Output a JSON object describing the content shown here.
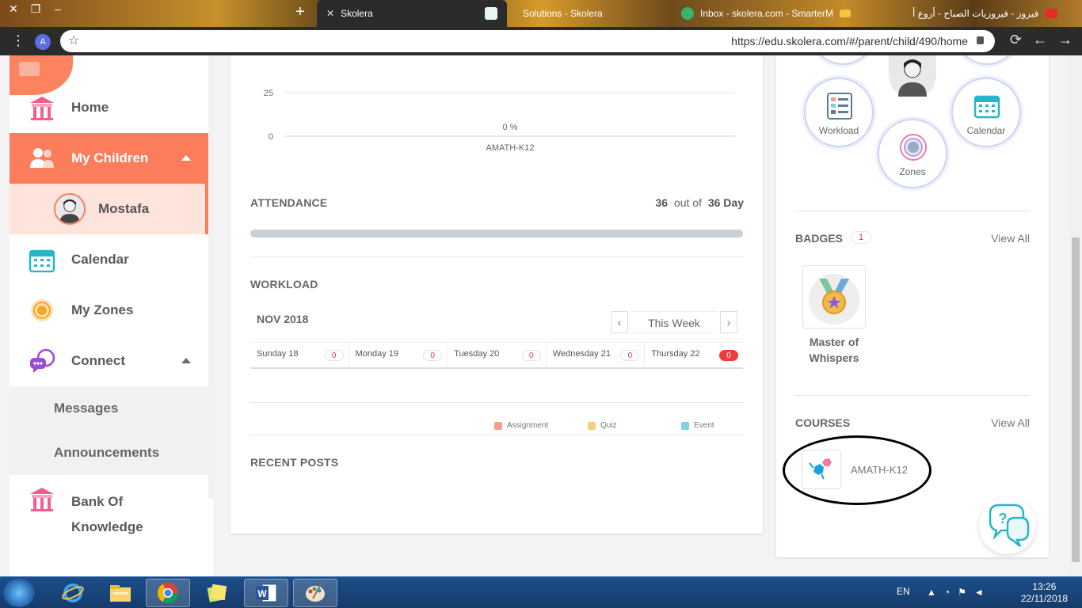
{
  "browser": {
    "tabs": [
      {
        "label": "Skolera",
        "active": true
      },
      {
        "label": "Solutions - Skolera",
        "active": false
      },
      {
        "label": "Inbox - skolera.com - SmarterM",
        "active": false
      },
      {
        "label": "فيروز - فيروزيات الصباح - أروع أ",
        "active": false
      }
    ],
    "url": "https://edu.skolera.com/#/parent/child/490/home",
    "profile_initial": "A"
  },
  "sidebar": {
    "items": [
      {
        "label": "Home"
      },
      {
        "label": "My Children"
      },
      {
        "label": "Mostafa"
      },
      {
        "label": "Calendar"
      },
      {
        "label": "My Zones"
      },
      {
        "label": "Connect"
      },
      {
        "label": "Messages"
      },
      {
        "label": "Announcements"
      },
      {
        "label": "Bank Of Knowledge"
      }
    ]
  },
  "chart_data": {
    "type": "bar",
    "categories": [
      "AMATH-K12"
    ],
    "values": [
      0
    ],
    "data_labels": [
      "0 %"
    ],
    "yticks": [
      0,
      25
    ],
    "ylim": [
      0,
      25
    ],
    "xlabel": "",
    "ylabel": "",
    "title": ""
  },
  "attendance": {
    "title": "ATTENDANCE",
    "attended": "36",
    "out_of_label": "out of",
    "total": "36 Day",
    "progress": 1.0
  },
  "workload": {
    "title": "WORKLOAD",
    "month": "NOV 2018",
    "week_label": "This Week",
    "days": [
      {
        "name": "Sunday 18",
        "count": "0",
        "hot": false
      },
      {
        "name": "Monday 19",
        "count": "0",
        "hot": false
      },
      {
        "name": "Tuesday 20",
        "count": "0",
        "hot": false
      },
      {
        "name": "Wednesday 21",
        "count": "0",
        "hot": false
      },
      {
        "name": "Thursday 22",
        "count": "0",
        "hot": true
      }
    ],
    "legend": [
      {
        "label": "Assignment",
        "color": "#f4a08a"
      },
      {
        "label": "Quiz",
        "color": "#f6cf7d"
      },
      {
        "label": "Event",
        "color": "#7ed3e0"
      }
    ]
  },
  "recent_posts": {
    "title": "RECENT POSTS"
  },
  "right_panel": {
    "bubbles": [
      {
        "label": "Workload",
        "icon": "workload-icon"
      },
      {
        "label": "Zones",
        "icon": "zones-icon"
      },
      {
        "label": "Calendar",
        "icon": "calendar-icon"
      }
    ],
    "badges": {
      "title": "BADGES",
      "count": "1",
      "view_all": "View All",
      "items": [
        {
          "name": "Master of Whispers"
        }
      ]
    },
    "courses": {
      "title": "COURSES",
      "view_all": "View All",
      "items": [
        {
          "name": "AMATH-K12"
        }
      ]
    }
  },
  "taskbar": {
    "language": "EN",
    "time": "13:26",
    "date": "22/11/2018"
  },
  "colors": {
    "accent": "#fb7d5c",
    "accent_light": "#ffe4dc",
    "hot_badge": "#f03a3a",
    "bubble_border": "#cfd4f2"
  }
}
